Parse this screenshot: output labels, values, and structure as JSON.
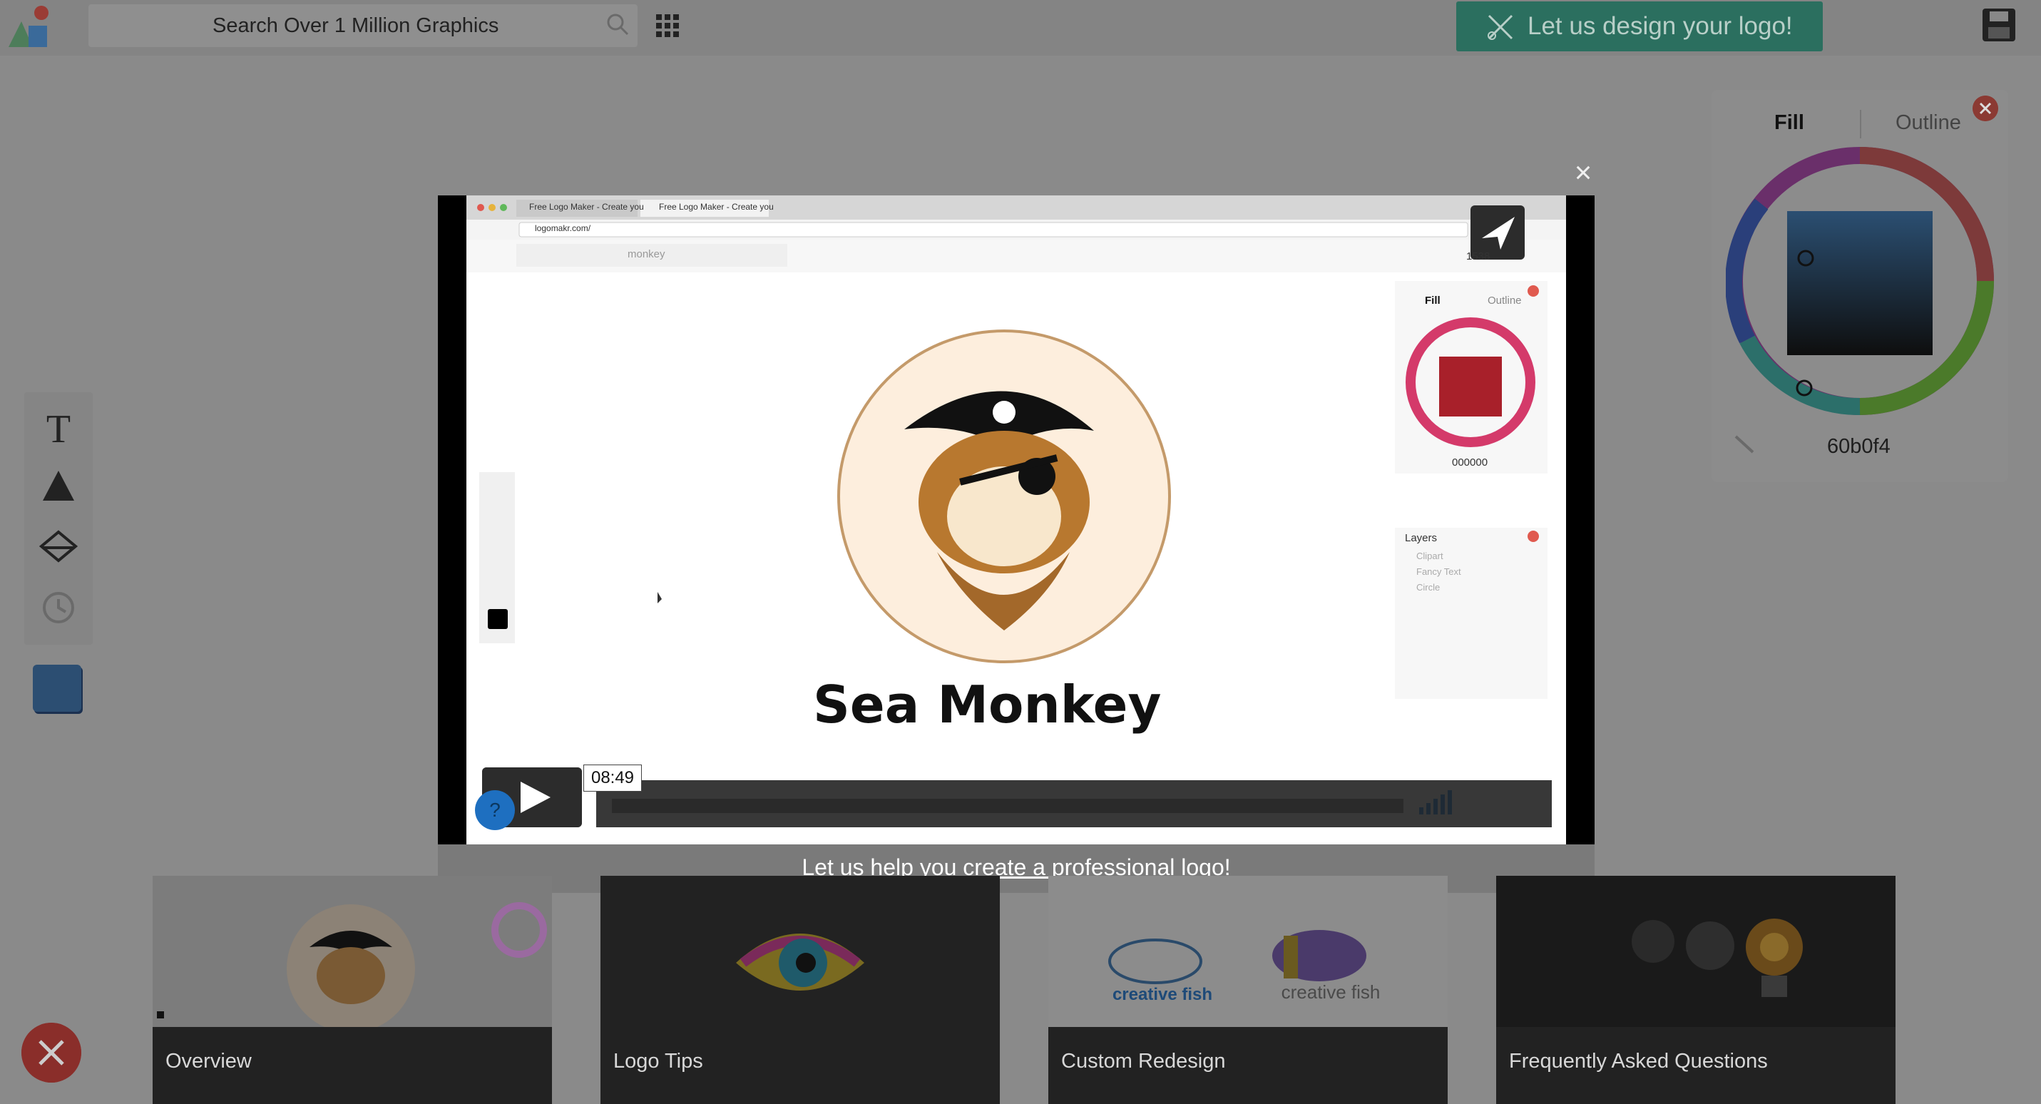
{
  "topbar": {
    "search_placeholder": "Search Over 1 Million Graphics",
    "design_button_label": "Let us design your logo!",
    "icons": [
      "logo-mark-icon",
      "search-icon",
      "grid-icon",
      "scissors-icon",
      "save-icon"
    ]
  },
  "tools": {
    "items": [
      "text-tool-icon",
      "shape-tool-icon",
      "eraser-tool-icon",
      "history-icon"
    ],
    "swatch_color": "#2c4e72"
  },
  "fill_panel": {
    "tab_fill": "Fill",
    "tab_outline": "Outline",
    "hex_value": "60b0f4"
  },
  "video": {
    "time": "08:49",
    "caption_link": "Let us help you create a professional logo!",
    "inner": {
      "tab1": "Free Logo Maker - Create you",
      "tab2": "Free Logo Maker - Create you",
      "url": "logomakr.com/",
      "search_value": "monkey",
      "count": "1538",
      "fill": "Fill",
      "outline": "Outline",
      "hex": "000000",
      "layers_title": "Layers",
      "layers": [
        "Clipart",
        "Fancy Text",
        "Circle"
      ],
      "logo_text": "Sea Monkey"
    }
  },
  "cards": [
    {
      "label": "Overview"
    },
    {
      "label": "Logo Tips"
    },
    {
      "label": "Custom Redesign",
      "thumb_text_1": "creative fish",
      "thumb_text_2": "creative fish"
    },
    {
      "label": "Frequently Asked Questions"
    }
  ],
  "colors": {
    "accent_teal": "#2b6f5f",
    "close_red": "#8b3a33",
    "link_white": "#ffffff"
  }
}
